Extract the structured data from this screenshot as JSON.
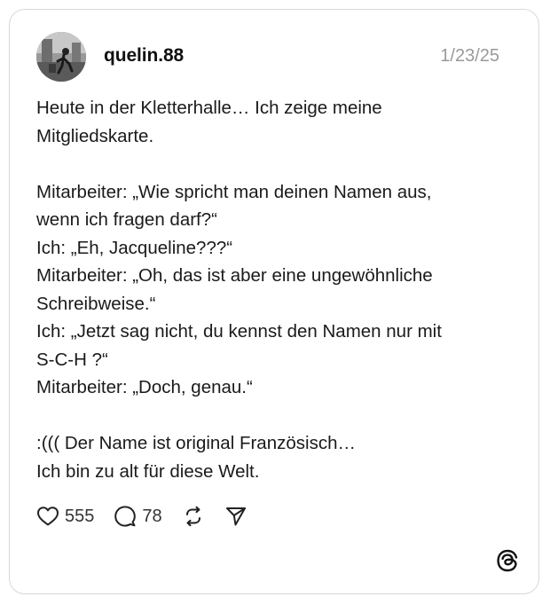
{
  "post": {
    "username": "quelin.88",
    "date": "1/23/25",
    "lines": [
      "Heute in der Kletterhalle… Ich zeige meine",
      "Mitgliedskarte.",
      "",
      "Mitarbeiter: „Wie spricht man deinen Namen aus,",
      "wenn ich fragen darf?“",
      "Ich: „Eh, Jacqueline???“",
      "Mitarbeiter: „Oh, das ist aber eine ungewöhnliche",
      "Schreibweise.“",
      "Ich: „Jetzt sag nicht, du kennst den Namen nur mit",
      "S-C-H ?“",
      "Mitarbeiter: „Doch, genau.“",
      "",
      ":((( Der Name ist original Französisch…",
      "Ich bin zu alt für diese Welt."
    ]
  },
  "actions": {
    "likes": "555",
    "comments": "78"
  },
  "icons": {
    "like": "heart-icon",
    "comment": "comment-bubble-icon",
    "repost": "repost-icon",
    "share": "send-icon",
    "brand": "threads-logo-icon"
  },
  "colors": {
    "text": "#111111",
    "muted": "#999999",
    "border": "#d8d8d8"
  }
}
